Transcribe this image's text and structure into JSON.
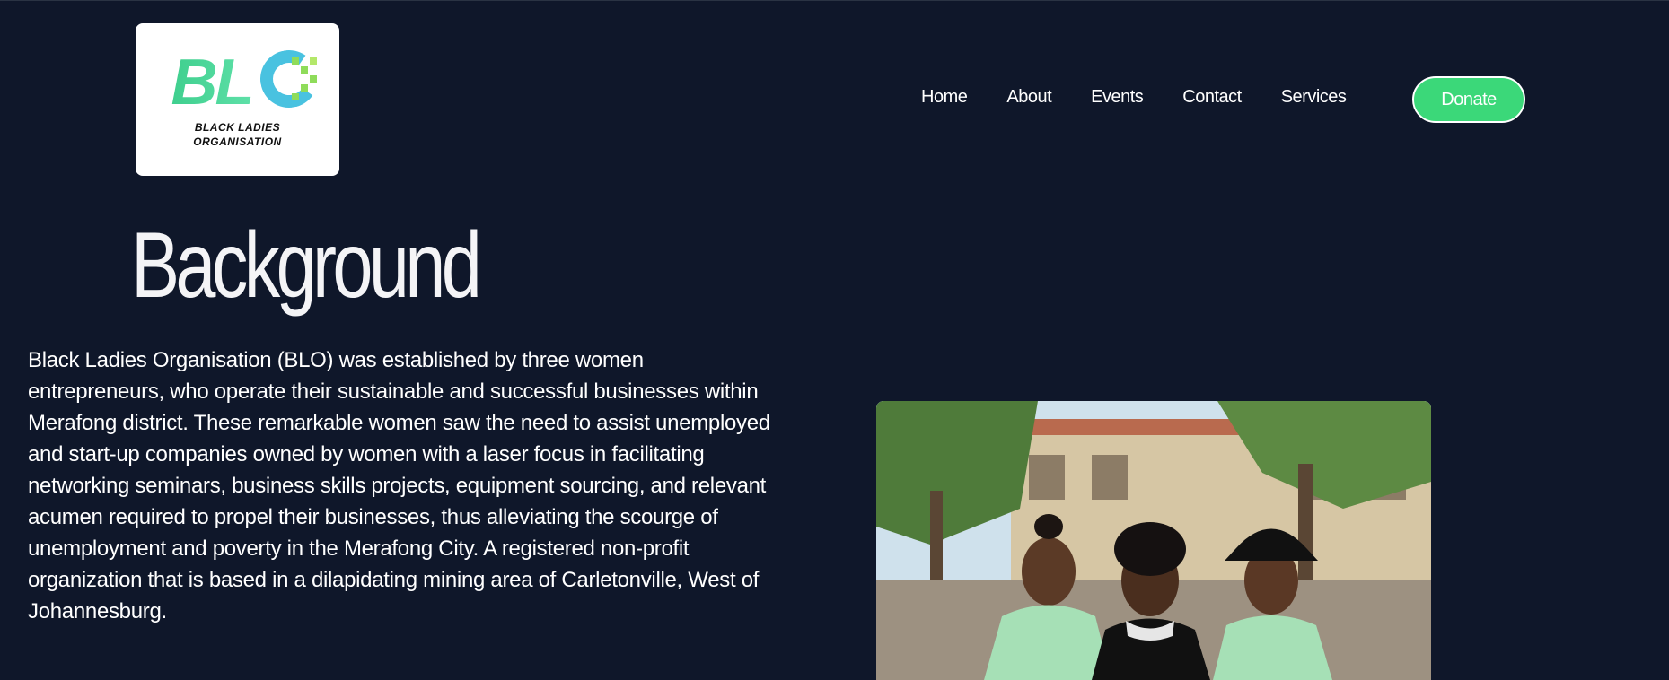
{
  "logo": {
    "mark": "BLO",
    "line1": "BLACK LADIES",
    "line2": "ORGANISATION"
  },
  "nav": {
    "items": [
      "Home",
      "About",
      "Events",
      "Contact",
      "Services"
    ],
    "donate": "Donate"
  },
  "page": {
    "title": "Background",
    "body": "Black Ladies Organisation (BLO) was established by three women entrepreneurs, who operate their sustainable and successful businesses within Merafong district. These remarkable women saw the need to assist unemployed and start-up companies owned by women with a laser focus in facilitating networking seminars, business skills projects, equipment sourcing, and relevant acumen required to propel their businesses, thus alleviating the scourge of unemployment and poverty in the Merafong City. A registered non-profit organization that is based in a dilapidating mining area of Carletonville, West of Johannesburg."
  },
  "colors": {
    "background": "#0f172a",
    "accent": "#3bd879",
    "text": "#ffffff"
  }
}
